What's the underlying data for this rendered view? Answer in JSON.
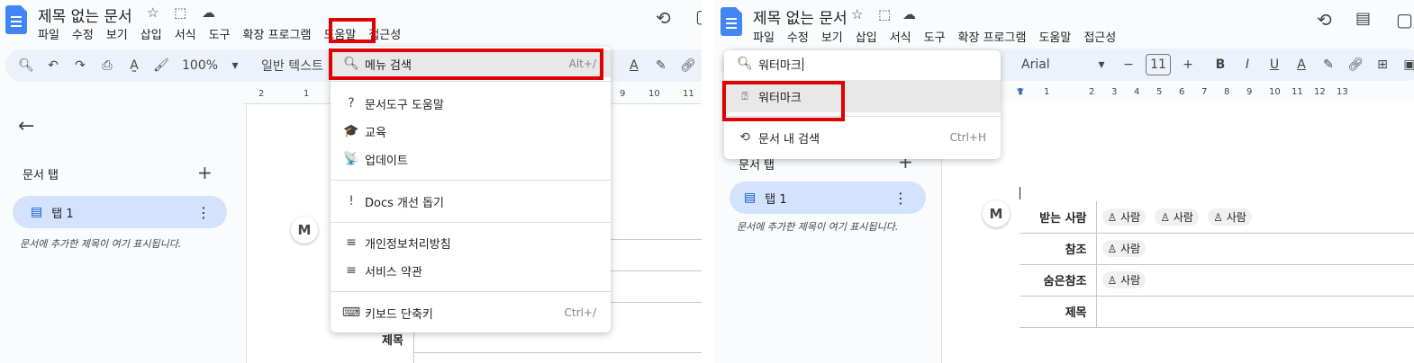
{
  "doc": {
    "title": "제목 없는 문서",
    "menu": [
      "파일",
      "수정",
      "보기",
      "삽입",
      "서식",
      "도구",
      "확장 프로그램",
      "도움말",
      "접근성"
    ]
  },
  "left": {
    "toolbar": {
      "zoom": "100%",
      "style": "일반 텍스트"
    },
    "ruler": [
      "2",
      "1",
      "9",
      "10",
      "11"
    ],
    "sidebar": {
      "heading": "문서 탭",
      "tab_label": "탭 1",
      "note": "문서에 추가한 제목이 여기 표시됩니다."
    },
    "help_menu": {
      "search_label": "메뉴 검색",
      "search_shortcut": "Alt+/",
      "items": [
        {
          "icon": "help-circle-icon",
          "glyph": "?",
          "label": "문서도구 도움말"
        },
        {
          "icon": "graduation-cap-icon",
          "glyph": "🎓",
          "label": "교육"
        },
        {
          "icon": "broadcast-icon",
          "glyph": "📡",
          "label": "업데이트"
        },
        {
          "icon": "feedback-icon",
          "glyph": "!",
          "label": "Docs 개선 돕기"
        },
        {
          "icon": "document-icon",
          "glyph": "≡",
          "label": "개인정보처리방침"
        },
        {
          "icon": "document-icon",
          "glyph": "≡",
          "label": "서비스 약관"
        },
        {
          "icon": "keyboard-icon",
          "glyph": "⌨",
          "label": "키보드 단축키",
          "shortcut": "Ctrl+/"
        }
      ]
    },
    "doc_label_subject": "제목"
  },
  "right": {
    "toolbar": {
      "font": "Arial",
      "font_size": "11"
    },
    "ruler": [
      "1",
      "1",
      "2",
      "3",
      "4",
      "5",
      "6",
      "7",
      "8",
      "9",
      "10",
      "11",
      "12",
      "13"
    ],
    "search": {
      "value": "워터마크",
      "result": "워터마크",
      "find_label": "문서 내 검색",
      "find_shortcut": "Ctrl+H"
    },
    "sidebar": {
      "heading": "문서 탭",
      "tab_label": "탭 1",
      "note": "문서에 추가한 제목이 여기 표시됩니다."
    },
    "recipients": {
      "rows": [
        {
          "label": "받는 사람",
          "chips": [
            "사람",
            "사람",
            "사람"
          ]
        },
        {
          "label": "참조",
          "chips": [
            "사람"
          ]
        },
        {
          "label": "숨은참조",
          "chips": [
            "사람"
          ]
        },
        {
          "label": "제목",
          "chips": []
        }
      ]
    }
  },
  "colors": {
    "accent": "#4285f4",
    "highlight": "#e00000",
    "toolbar_bg": "#edf2fa",
    "tab_bg": "#d3e3fd"
  }
}
